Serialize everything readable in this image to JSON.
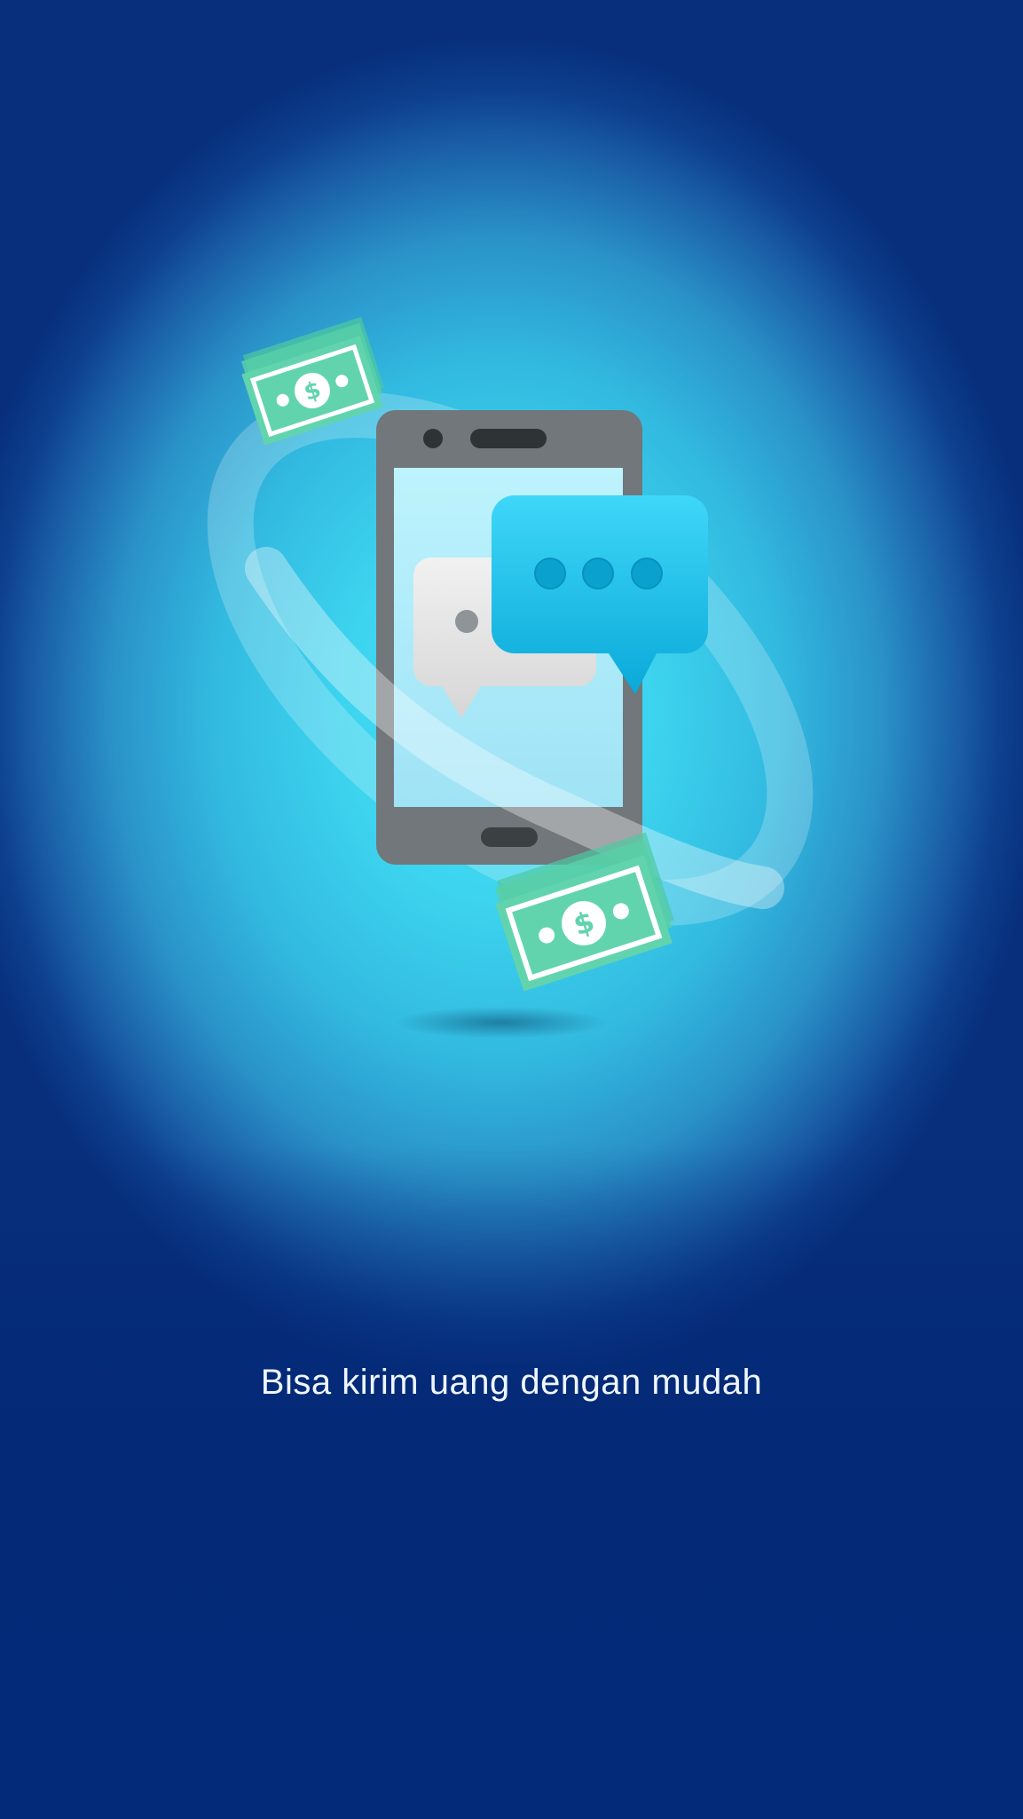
{
  "onboarding": {
    "message": "Bisa kirim uang dengan mudah"
  },
  "illustration": {
    "icons": [
      "smartphone-icon",
      "chat-bubble-icon",
      "banknote-icon"
    ]
  },
  "colors": {
    "background_top": "#1d6fb0",
    "background_glow": "#43dcf4",
    "background_bottom": "#022a78",
    "banknote": "#5fd3ad",
    "chat_bubble": "#1cc3ec",
    "phone_body": "#717679"
  }
}
